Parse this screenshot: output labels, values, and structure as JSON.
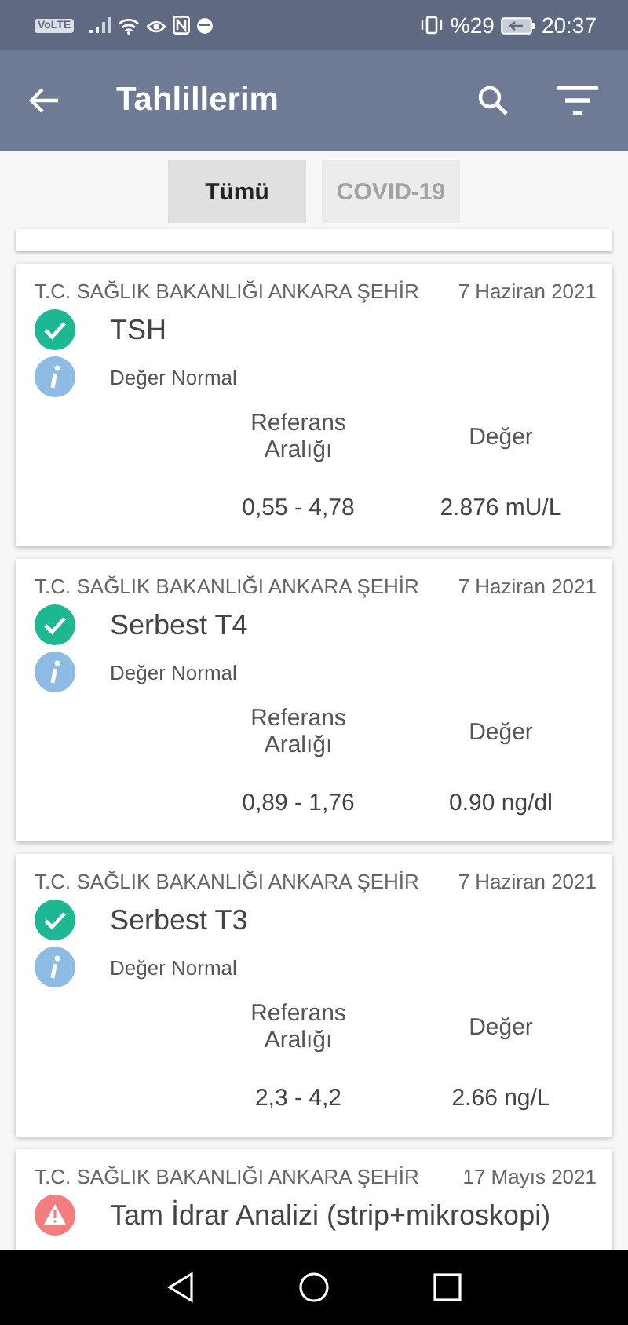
{
  "status_bar": {
    "network_badge": "VoLTE",
    "battery": "%29",
    "time": "20:37"
  },
  "app_bar": {
    "title": "Tahlillerim"
  },
  "tabs": [
    {
      "label": "Tümü",
      "selected": true
    },
    {
      "label": "COVID-19",
      "selected": false
    }
  ],
  "results": [
    {
      "hospital": "T.C. SAĞLIK BAKANLIĞI ANKARA ŞEHİR",
      "date": "7 Haziran 2021",
      "kind": "normal",
      "name": "TSH",
      "status": "Değer Normal",
      "reference_label": "Referans Aralığı",
      "value_label": "Değer",
      "reference": "0,55 - 4,78",
      "value": "2.876 mU/L"
    },
    {
      "hospital": "T.C. SAĞLIK BAKANLIĞI ANKARA ŞEHİR",
      "date": "7 Haziran 2021",
      "kind": "normal",
      "name": "Serbest T4",
      "status": "Değer Normal",
      "reference_label": "Referans Aralığı",
      "value_label": "Değer",
      "reference": "0,89 - 1,76",
      "value": "0.90 ng/dl"
    },
    {
      "hospital": "T.C. SAĞLIK BAKANLIĞI ANKARA ŞEHİR",
      "date": "7 Haziran 2021",
      "kind": "normal",
      "name": "Serbest T3",
      "status": "Değer Normal",
      "reference_label": "Referans Aralığı",
      "value_label": "Değer",
      "reference": "2,3 - 4,2",
      "value": "2.66 ng/L"
    },
    {
      "hospital": "T.C. SAĞLIK BAKANLIĞI ANKARA ŞEHİR",
      "date": "17 Mayıs 2021",
      "kind": "warning",
      "name": "Tam İdrar Analizi (strip+mikroskopi)"
    }
  ]
}
